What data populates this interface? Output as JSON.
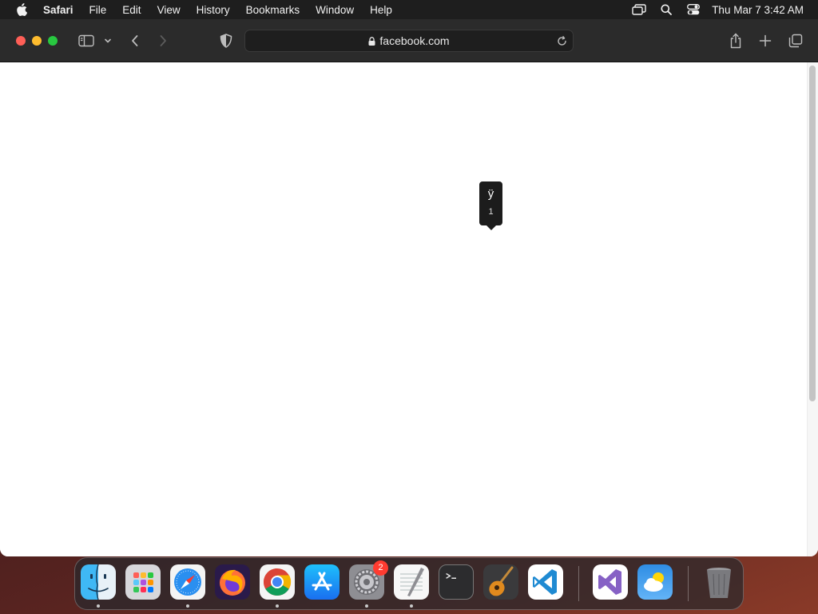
{
  "menubar": {
    "apple_icon": "apple-logo-icon",
    "app_name": "Safari",
    "items": [
      "File",
      "Edit",
      "View",
      "History",
      "Bookmarks",
      "Window",
      "Help"
    ],
    "status_icons": [
      "screen-mirroring-icon",
      "spotlight-search-icon",
      "control-center-icon"
    ],
    "clock": "Thu Mar 7  3:42 AM"
  },
  "browser": {
    "url": "facebook.com",
    "traffic_colors": {
      "close": "#ff5f57",
      "minimize": "#febc2e",
      "maximize": "#28c840"
    }
  },
  "tooltip": {
    "character": "ÿ",
    "number": "1"
  },
  "dock": {
    "apps": [
      "Finder",
      "Launchpad",
      "Safari",
      "Firefox",
      "Google Chrome",
      "App Store",
      "System Settings",
      "TextEdit",
      "Terminal",
      "GarageBand",
      "Visual Studio Code",
      "Visual Studio",
      "Weather",
      "Trash"
    ],
    "system_settings_badge": "2"
  }
}
